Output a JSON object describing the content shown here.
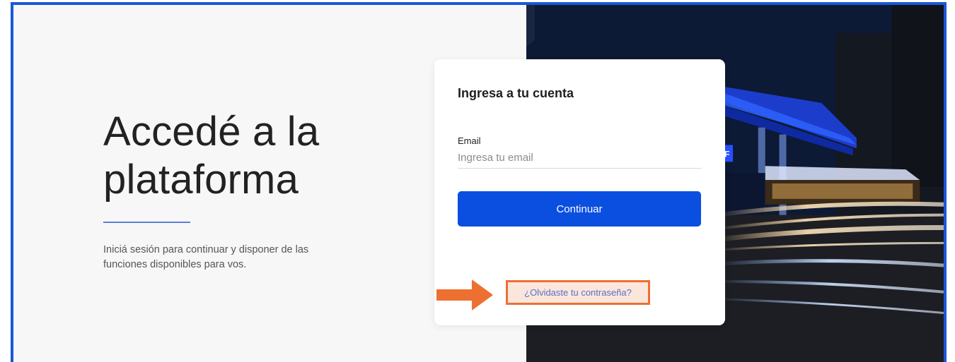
{
  "hero": {
    "title_line1": "Accedé a la",
    "title_line2": "plataforma",
    "subtitle_line1": "Iniciá sesión para continuar y disponer de las",
    "subtitle_line2": "funciones disponibles para vos."
  },
  "login": {
    "title": "Ingresa a tu cuenta",
    "email_label": "Email",
    "email_placeholder": "Ingresa tu email",
    "email_value": "",
    "continue_label": "Continuar",
    "forgot_label": "¿Olvidaste tu contraseña?"
  },
  "background": {
    "brand_fragment": "PF"
  },
  "colors": {
    "frame_border": "#1a56d9",
    "primary_button": "#0a4fe0",
    "annotation_orange": "#ed7031",
    "link": "#5a6fc4"
  }
}
